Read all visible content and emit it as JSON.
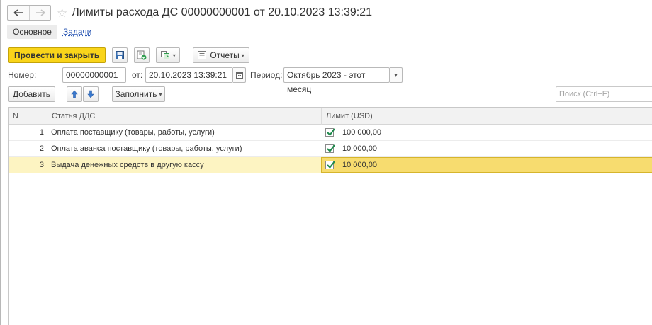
{
  "window": {
    "title": "Лимиты расхода ДС 00000000001 от 20.10.2023 13:39:21",
    "back_glyph": "🡐",
    "forward_glyph": "🡒",
    "star_glyph": "☆"
  },
  "tabs": [
    {
      "label": "Основное",
      "active": true
    },
    {
      "label": "Задачи",
      "active": false
    }
  ],
  "toolbar": {
    "post_close_label": "Провести и закрыть",
    "reports_label": "Отчеты",
    "caret": "▾"
  },
  "form": {
    "number_label": "Номер:",
    "number_value": "00000000001",
    "date_label": "от:",
    "date_value": "20.10.2023 13:39:21",
    "period_label": "Период:",
    "period_value": "Октябрь 2023 - этот месяц"
  },
  "commands": {
    "add_label": "Добавить",
    "fill_label": "Заполнить",
    "search_placeholder": "Поиск (Ctrl+F)"
  },
  "table": {
    "columns": {
      "n": "N",
      "item": "Статья ДДС",
      "limit": "Лимит (USD)"
    },
    "rows": [
      {
        "n": "1",
        "item": "Оплата поставщику (товары, работы, услуги)",
        "limit": "100 000,00",
        "checked": true
      },
      {
        "n": "2",
        "item": "Оплата аванса поставщику (товары, работы, услуги)",
        "limit": "10 000,00",
        "checked": true
      },
      {
        "n": "3",
        "item": "Выдача денежных средств в другую кассу",
        "limit": "10 000,00",
        "checked": true,
        "selected": true
      }
    ]
  },
  "colors": {
    "primary_button": "#f9d41a",
    "selected_row": "#fdf4c2",
    "selected_cell": "#f7dc6f",
    "check": "#1e8a4c",
    "link": "#2f5bb5"
  }
}
